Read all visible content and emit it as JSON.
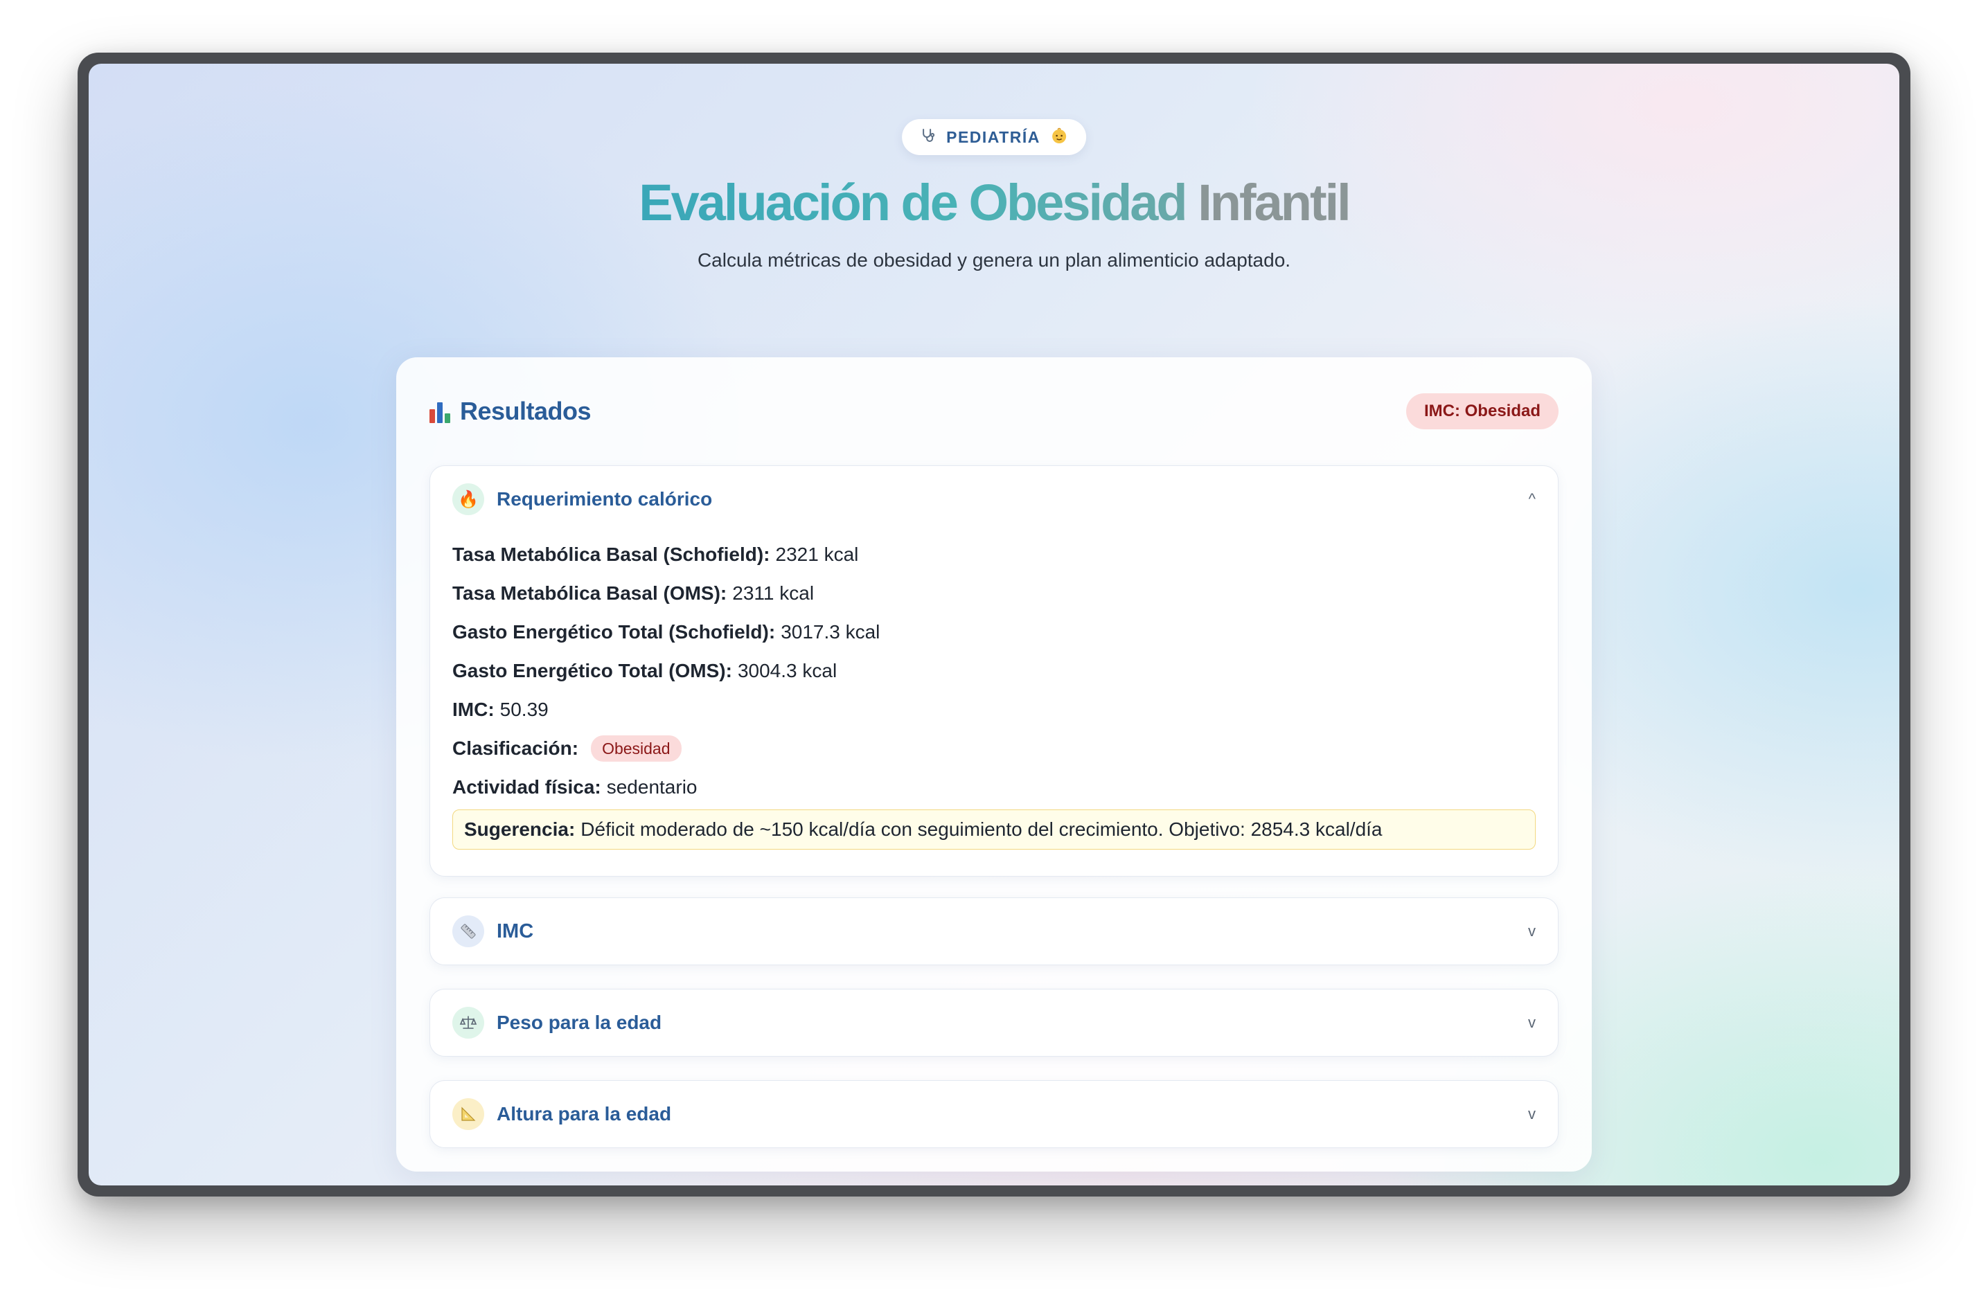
{
  "header": {
    "badge_label": "PEDIATRÍA",
    "badge_left_icon": "stethoscope-icon",
    "badge_right_icon": "baby-icon",
    "title_part1": "Evaluación de Obesidad",
    "title_part2": "Infantil",
    "subtitle": "Calcula métricas de obesidad y genera un plan alimenticio adaptado."
  },
  "results": {
    "title": "Resultados",
    "title_icon": "bar-chart-icon",
    "status_pill": "IMC: Obesidad",
    "colors": {
      "pill_bg": "#fbdbdb",
      "pill_text": "#8b1818",
      "accent": "#2a5c98"
    }
  },
  "sections": [
    {
      "title": "Requerimiento calórico",
      "icon": "fire-icon",
      "icon_glyph": "🔥",
      "expanded": true,
      "chevron": "^",
      "rows": [
        {
          "label": "Tasa Metabólica Basal (Schofield):",
          "value": "2321 kcal"
        },
        {
          "label": "Tasa Metabólica Basal (OMS):",
          "value": "2311 kcal"
        },
        {
          "label": "Gasto Energético Total (Schofield):",
          "value": "3017.3 kcal"
        },
        {
          "label": "Gasto Energético Total (OMS):",
          "value": "3004.3 kcal"
        },
        {
          "label": "IMC:",
          "value": "50.39"
        },
        {
          "label": "Clasificación:",
          "value": "Obesidad"
        },
        {
          "label": "Actividad física:",
          "value": "sedentario"
        }
      ],
      "suggestion_label": "Sugerencia:",
      "suggestion_text": "Déficit moderado de ~150 kcal/día con seguimiento del crecimiento. Objetivo: 2854.3 kcal/día"
    },
    {
      "title": "IMC",
      "icon": "ruler-icon",
      "icon_glyph": "📏",
      "expanded": false,
      "chevron": "v"
    },
    {
      "title": "Peso para la edad",
      "icon": "scale-icon",
      "icon_glyph": "⚖",
      "expanded": false,
      "chevron": "v"
    },
    {
      "title": "Altura para la edad",
      "icon": "triangle-ruler-icon",
      "icon_glyph": "📐",
      "expanded": false,
      "chevron": "v"
    }
  ]
}
